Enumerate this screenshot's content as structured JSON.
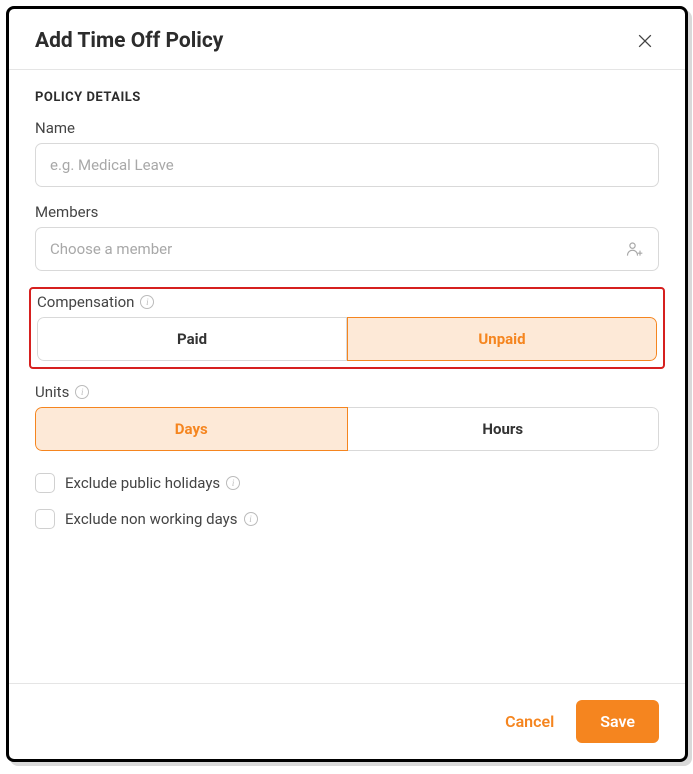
{
  "modal": {
    "title": "Add Time Off Policy"
  },
  "section": {
    "details": "POLICY DETAILS"
  },
  "fields": {
    "name": {
      "label": "Name",
      "placeholder": "e.g. Medical Leave",
      "value": ""
    },
    "members": {
      "label": "Members",
      "placeholder": "Choose a member",
      "value": ""
    },
    "compensation": {
      "label": "Compensation",
      "options": {
        "paid": "Paid",
        "unpaid": "Unpaid"
      },
      "selected": "unpaid"
    },
    "units": {
      "label": "Units",
      "options": {
        "days": "Days",
        "hours": "Hours"
      },
      "selected": "days"
    },
    "exclude_holidays": {
      "label": "Exclude public holidays",
      "checked": false
    },
    "exclude_nonworking": {
      "label": "Exclude non working days",
      "checked": false
    }
  },
  "footer": {
    "cancel": "Cancel",
    "save": "Save"
  }
}
